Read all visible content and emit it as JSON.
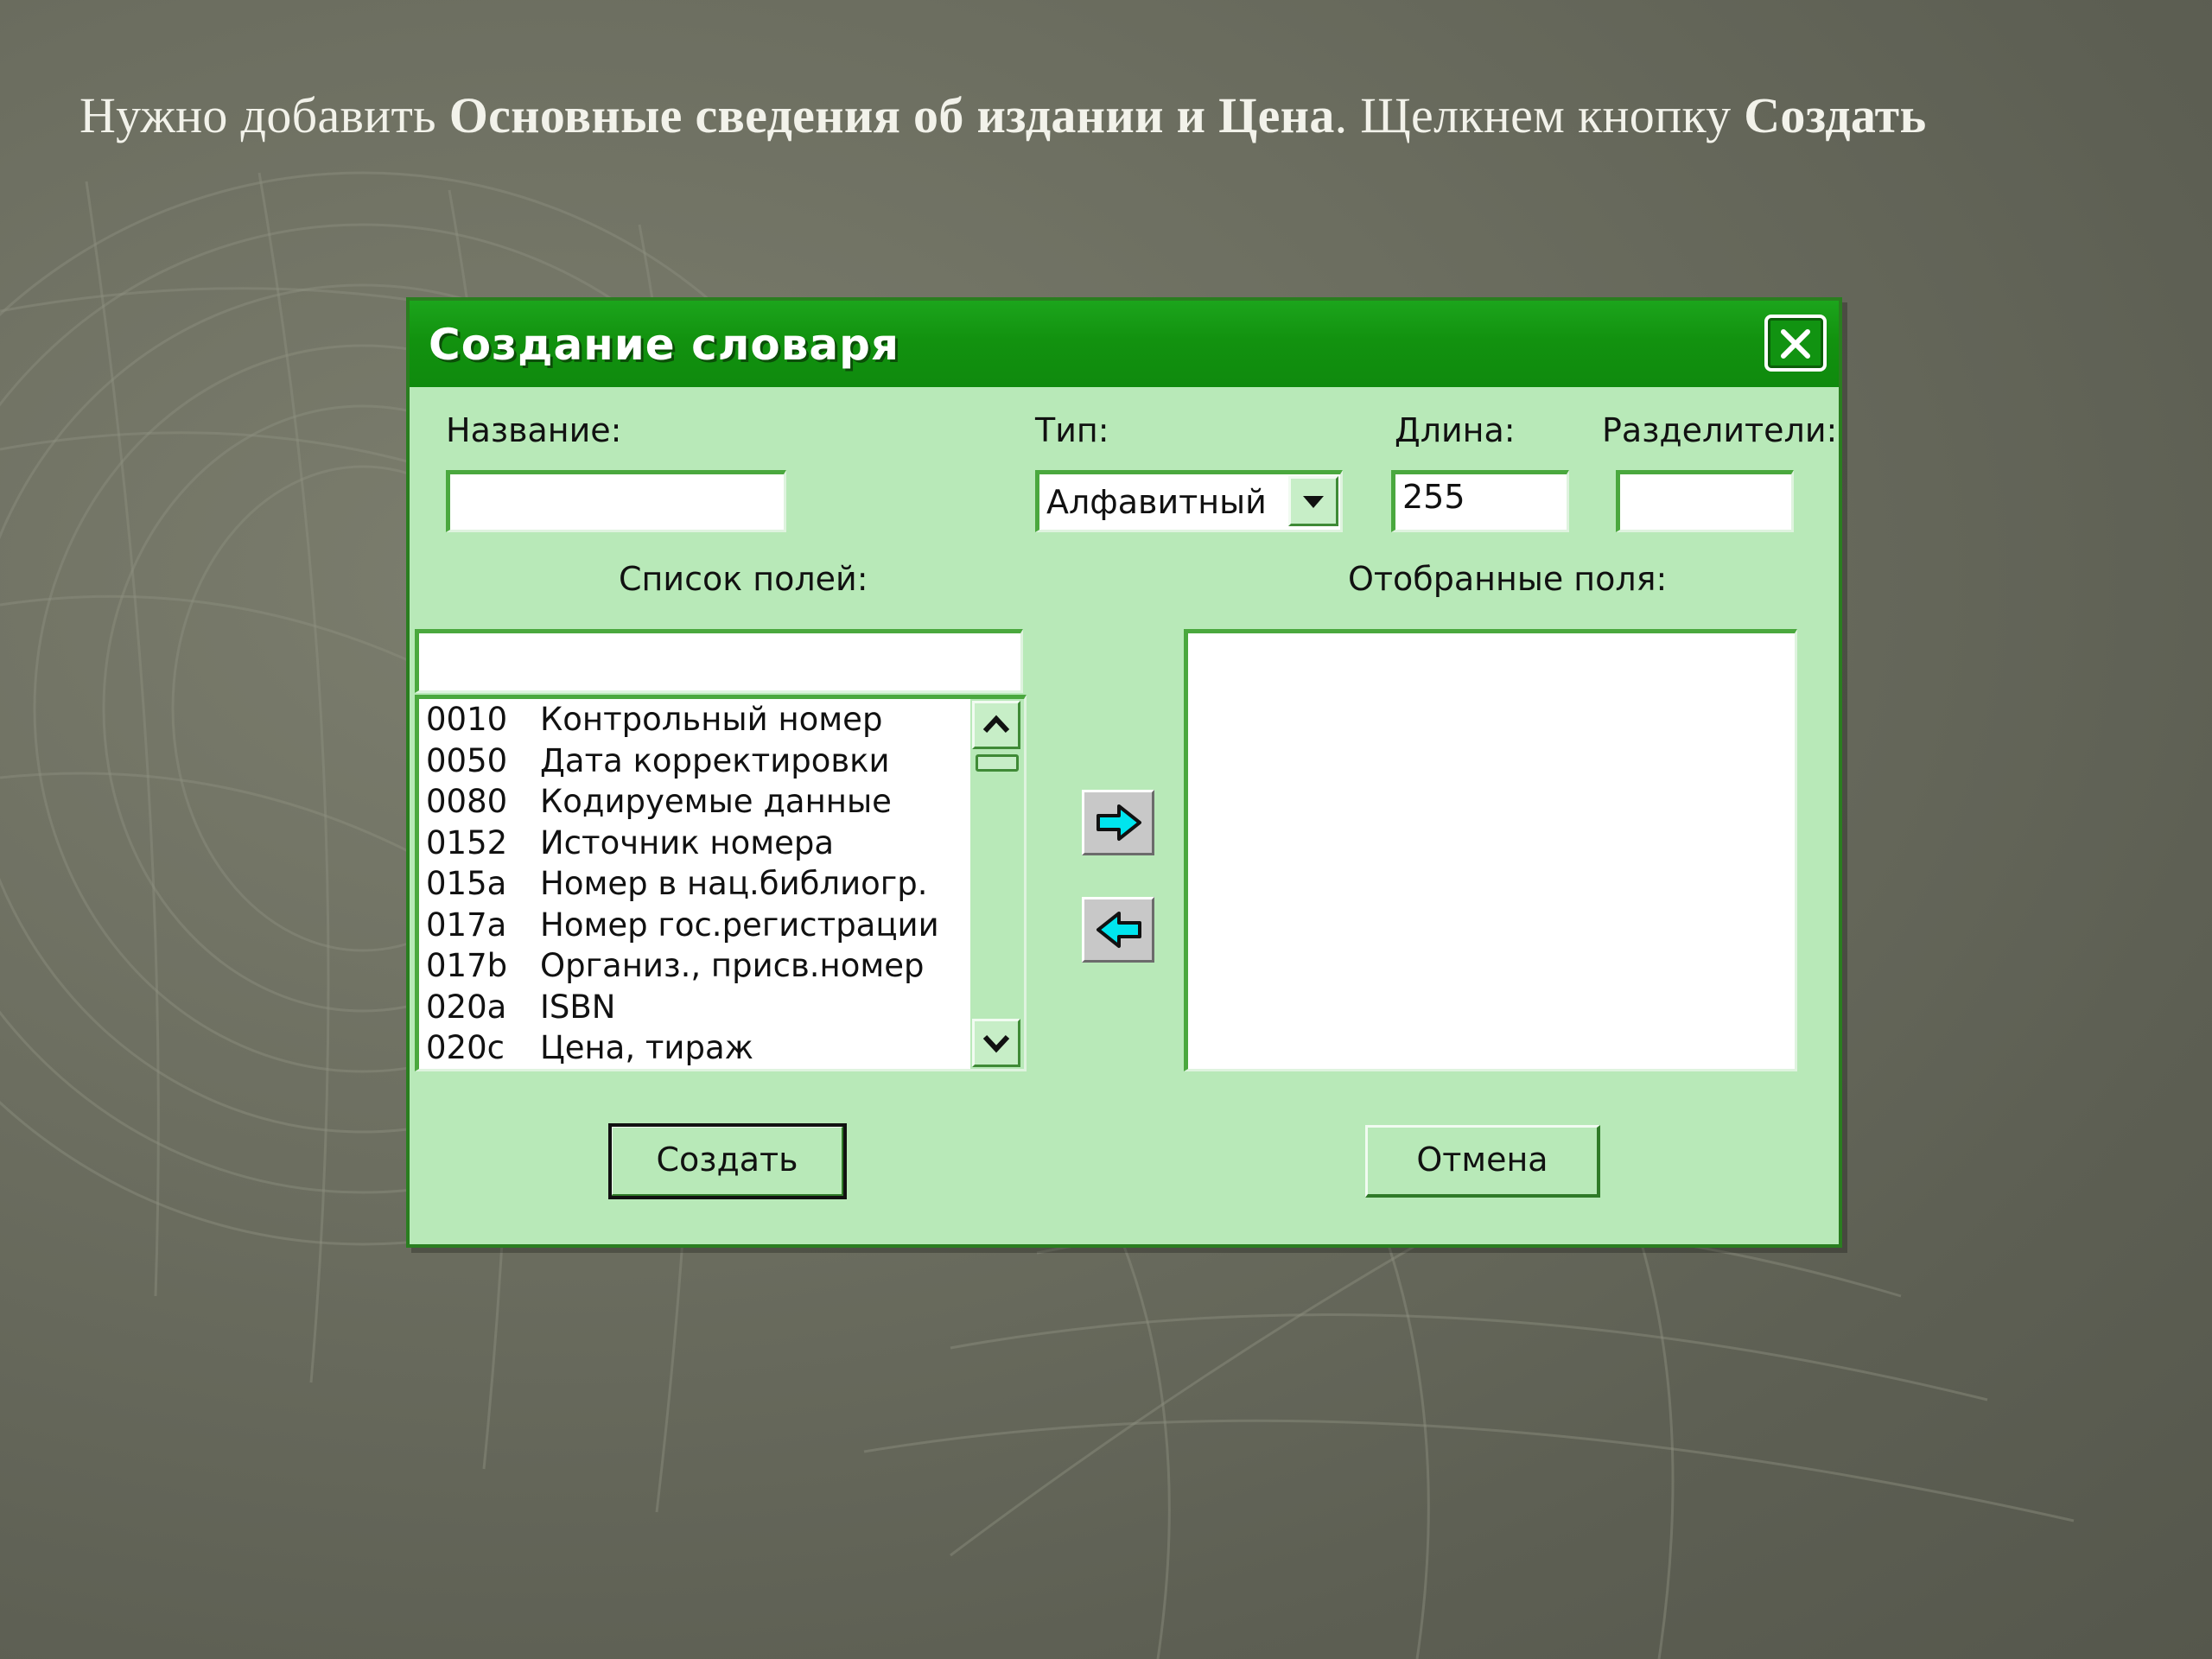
{
  "caption": {
    "part1": "Нужно добавить ",
    "part2_bold": "Основные сведения об издании и Цена",
    "part3": ". Щелкнем кнопку ",
    "part4_bold": "Создать"
  },
  "dialog": {
    "title": "Создание словаря",
    "labels": {
      "name": "Название:",
      "type": "Тип:",
      "length": "Длина:",
      "separators": "Разделители:",
      "field_list": "Список полей:",
      "selected_fields": "Отобранные поля:"
    },
    "name_value": "",
    "type_value": "Алфавитный",
    "length_value": "255",
    "separators_value": "",
    "filter_value": "",
    "fields": [
      {
        "code": "0010",
        "name": "Контрольный номер"
      },
      {
        "code": "0050",
        "name": "Дата корректировки"
      },
      {
        "code": "0080",
        "name": "Кодируемые данные"
      },
      {
        "code": "0152",
        "name": "Источник номера"
      },
      {
        "code": "015a",
        "name": "Номер в нац.библиогр."
      },
      {
        "code": "017a",
        "name": "Номер гос.регистрации"
      },
      {
        "code": "017b",
        "name": "Организ., присв.номер"
      },
      {
        "code": "020a",
        "name": "ISBN"
      },
      {
        "code": "020c",
        "name": "Цена, тираж"
      }
    ],
    "buttons": {
      "create": "Создать",
      "cancel": "Отмена"
    }
  },
  "colors": {
    "title_bar": "#12920f",
    "dialog_bg": "#b8e9b8",
    "arrow_cyan": "#00e5ee"
  }
}
